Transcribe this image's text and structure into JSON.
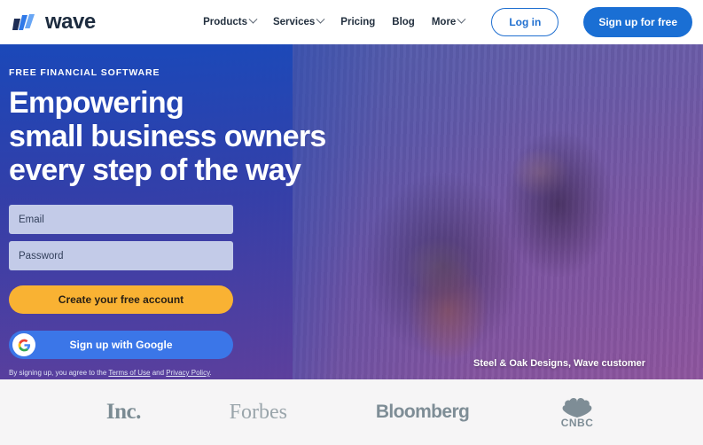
{
  "header": {
    "logo_text": "wave",
    "logo_icon": "wave-logo-icon",
    "nav": [
      {
        "label": "Products",
        "has_chevron": true
      },
      {
        "label": "Services",
        "has_chevron": true
      },
      {
        "label": "Pricing",
        "has_chevron": false
      },
      {
        "label": "Blog",
        "has_chevron": false
      },
      {
        "label": "More",
        "has_chevron": true
      }
    ],
    "login_label": "Log in",
    "signup_label": "Sign up for free"
  },
  "hero": {
    "eyebrow": "FREE FINANCIAL SOFTWARE",
    "headline_line1": "Empowering",
    "headline_line2": "small business owners",
    "headline_line3": "every step of the way",
    "email_placeholder": "Email",
    "email_value": "",
    "password_placeholder": "Password",
    "password_value": "",
    "cta_label": "Create your free account",
    "google_label": "Sign up with Google",
    "google_icon": "google-icon",
    "legal_prefix": "By signing up, you agree to the ",
    "legal_terms": "Terms of Use",
    "legal_middle": " and ",
    "legal_privacy": "Privacy Policy",
    "legal_suffix": ".",
    "photo_caption": "Steel & Oak Designs, Wave customer",
    "photo_alt": "Two woodworkers reviewing plans on a workbench"
  },
  "press": {
    "logos": [
      {
        "name": "Inc.",
        "icon": "inc-logo"
      },
      {
        "name": "Forbes",
        "icon": "forbes-logo"
      },
      {
        "name": "Bloomberg",
        "icon": "bloomberg-logo"
      },
      {
        "name": "CNBC",
        "icon": "cnbc-logo"
      }
    ]
  },
  "colors": {
    "brand_blue": "#1a6fd4",
    "cta_yellow": "#f9b233",
    "google_blue": "#3b76e8",
    "field_lavender": "#c3cbe8",
    "logobar_bg": "#f6f5f6",
    "press_gray": "#7e8d96"
  }
}
